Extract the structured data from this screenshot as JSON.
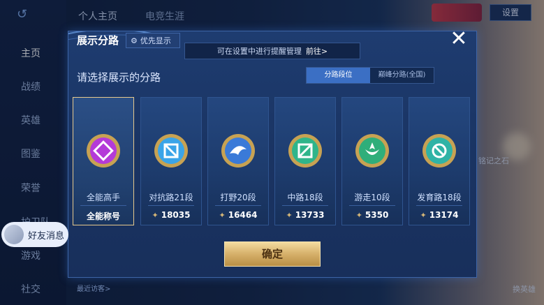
{
  "background": {
    "top_tabs": [
      "个人主页",
      "电竞生涯"
    ],
    "settings_label": "设置",
    "sidebar_items": [
      "主页",
      "战绩",
      "英雄",
      "图鉴",
      "荣誉",
      "护卫队",
      "游戏",
      "社交"
    ],
    "friend_message": "好友消息",
    "visitors_label": "最近访客>",
    "right_labels": [
      "铭记之石",
      "换英雄"
    ]
  },
  "modal": {
    "title": "展示分路",
    "priority_label": "优先显示",
    "hint_text": "可在设置中进行提醒管理",
    "hint_link": "前往>",
    "close_icon": "close-icon",
    "subtitle": "请选择展示的分路",
    "toggle": {
      "active": "分路段位",
      "inactive": "巅峰分路(全国)"
    },
    "confirm_label": "确定",
    "cards": [
      {
        "name": "全能高手",
        "stat": "全能称号",
        "has_arrow": false,
        "icon": "allround-emblem-icon",
        "color": "#b43ad8",
        "selected": true
      },
      {
        "name": "对抗路21段",
        "stat": "18035",
        "has_arrow": true,
        "icon": "clash-lane-emblem-icon",
        "color": "#3aa4e8",
        "selected": false
      },
      {
        "name": "打野20段",
        "stat": "16464",
        "has_arrow": true,
        "icon": "jungle-emblem-icon",
        "color": "#3a7ad8",
        "selected": false
      },
      {
        "name": "中路18段",
        "stat": "13733",
        "has_arrow": true,
        "icon": "mid-lane-emblem-icon",
        "color": "#2fb58a",
        "selected": false
      },
      {
        "name": "游走10段",
        "stat": "5350",
        "has_arrow": true,
        "icon": "roam-emblem-icon",
        "color": "#2fae7a",
        "selected": false
      },
      {
        "name": "发育路18段",
        "stat": "13174",
        "has_arrow": true,
        "icon": "farm-lane-emblem-icon",
        "color": "#2fb3a6",
        "selected": false
      }
    ]
  },
  "colors": {
    "accent_blue": "#3b6fc4",
    "gold": "#d6b06a",
    "selected_border": "#e7c98c"
  }
}
